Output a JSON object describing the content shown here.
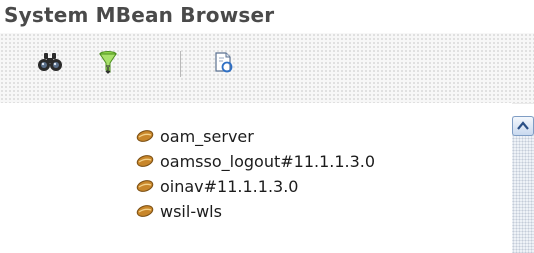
{
  "title": "System MBean Browser",
  "toolbar": {
    "buttons": [
      {
        "icon": "binoculars-icon"
      },
      {
        "icon": "filter-icon"
      },
      {
        "icon": "refresh-document-icon"
      }
    ]
  },
  "tree": {
    "items": [
      {
        "label": "oam_server",
        "icon": "bean-icon"
      },
      {
        "label": "oamsso_logout#11.1.1.3.0",
        "icon": "bean-icon"
      },
      {
        "label": "oinav#11.1.1.3.0",
        "icon": "bean-icon"
      },
      {
        "label": "wsil-wls",
        "icon": "bean-icon"
      }
    ]
  },
  "colors": {
    "title": "#4a4a4a",
    "bean": "#c8862a",
    "scrollbar_border": "#7f9dc4"
  }
}
